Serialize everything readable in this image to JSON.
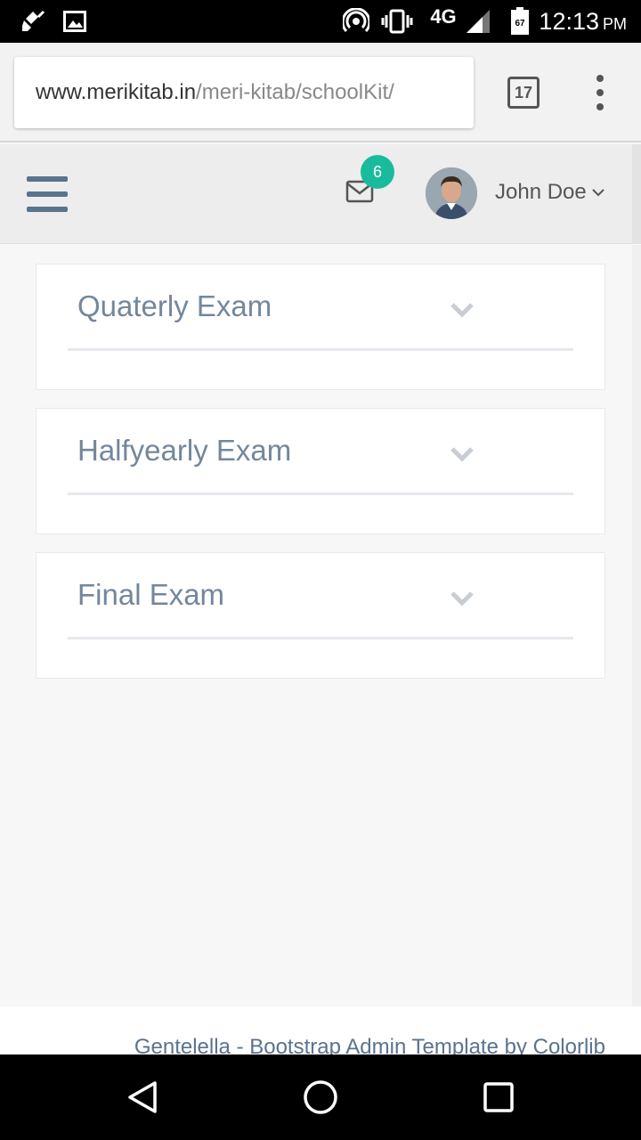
{
  "status_bar": {
    "time": "12:13",
    "ampm": "PM",
    "network": "4G",
    "battery": "67",
    "icons": [
      "cleaner-icon",
      "image-icon",
      "hotspot-icon",
      "vibrate-icon",
      "signal-icon",
      "battery-icon"
    ]
  },
  "browser": {
    "url_host": "www.merikitab.in",
    "url_path": "/meri-kitab/schoolKit/",
    "tab_count": "17"
  },
  "header": {
    "notification_count": "6",
    "user_name": "John Doe"
  },
  "panels": [
    {
      "title": "Quaterly Exam"
    },
    {
      "title": "Halfyearly Exam"
    },
    {
      "title": "Final Exam"
    }
  ],
  "footer": {
    "credit": "Gentelella - Bootstrap Admin Template by Colorlib"
  },
  "colors": {
    "accent": "#1abb9c",
    "panel_title": "#73879c",
    "nav_blue": "#5a738e"
  }
}
